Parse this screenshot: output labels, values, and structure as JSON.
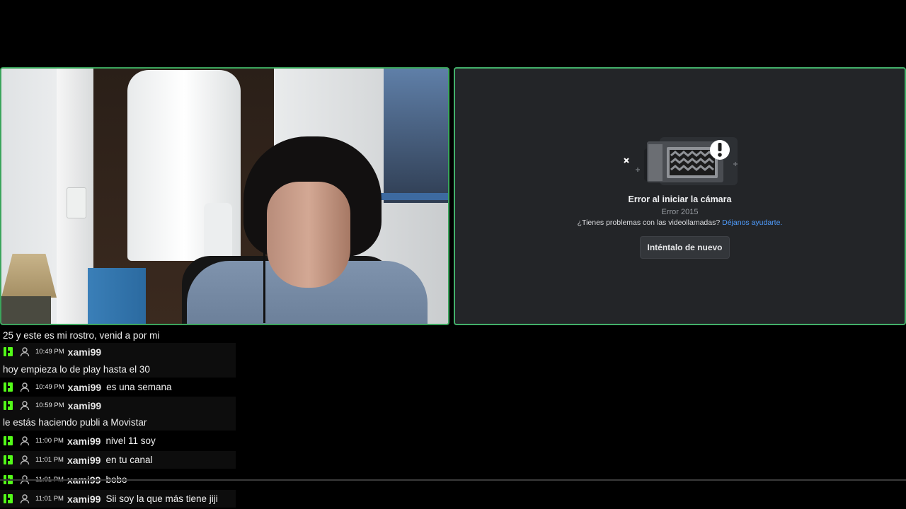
{
  "error_panel": {
    "title": "Error al iniciar la cámara",
    "code": "Error 2015",
    "help_text": "¿Tienes problemas con las videollamadas?",
    "help_link": "Déjanos ayudarte.",
    "retry_button": "Inténtalo de nuevo"
  },
  "chat": {
    "partial_line": "25 y este es mi rostro, venid a por mi",
    "messages": [
      {
        "time": "10:49 PM",
        "user": "xami99",
        "text": "",
        "continuation": "hoy empieza lo de play hasta el 30"
      },
      {
        "time": "10:49 PM",
        "user": "xami99",
        "text": "es una semana",
        "continuation": ""
      },
      {
        "time": "10:59 PM",
        "user": "xami99",
        "text": "",
        "continuation": "le estás haciendo publi a Movistar"
      },
      {
        "time": "11:00 PM",
        "user": "xami99",
        "text": "nivel 11 soy",
        "continuation": ""
      },
      {
        "time": "11:01 PM",
        "user": "xami99",
        "text": "en tu canal",
        "continuation": ""
      },
      {
        "time": "11:01 PM",
        "user": "xami99",
        "text": "bobo",
        "continuation": ""
      },
      {
        "time": "11:01 PM",
        "user": "xami99",
        "text": "Sii soy la que más tiene jiji",
        "continuation": ""
      }
    ]
  },
  "colors": {
    "speaking_border": "#3ba55c",
    "kick_badge": "#53fc18",
    "link": "#4f9dff"
  }
}
